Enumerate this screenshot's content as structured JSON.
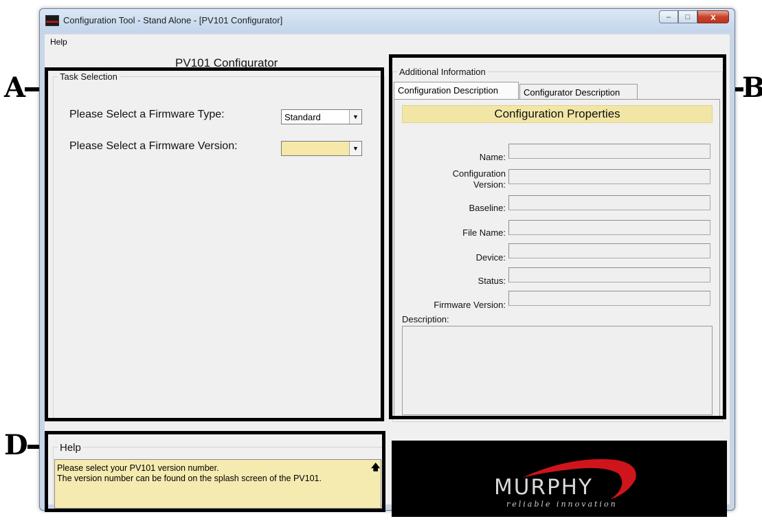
{
  "callouts": {
    "a": "A",
    "b": "B",
    "d": "D"
  },
  "window": {
    "title": "Configuration Tool - Stand Alone - [PV101 Configurator]",
    "controls": {
      "minimize": "–",
      "maximize": "□",
      "close": "x"
    }
  },
  "menu": {
    "items": [
      "Help"
    ]
  },
  "configurator": {
    "title": "PV101 Configurator",
    "task_selection": {
      "label": "Task Selection",
      "firmware_type_label": "Please Select a Firmware Type:",
      "firmware_type_value": "Standard",
      "firmware_version_label": "Please Select a Firmware Version:",
      "firmware_version_value": ""
    }
  },
  "additional_info": {
    "label": "Additional Information",
    "tabs": [
      "Configuration Description",
      "Configurator Description"
    ],
    "active_tab": "Configuration Description",
    "banner": "Configuration  Properties",
    "properties": [
      {
        "label": "Name:",
        "value": ""
      },
      {
        "label": "Configuration Version:",
        "value": ""
      },
      {
        "label": "Baseline:",
        "value": ""
      },
      {
        "label": "File Name:",
        "value": ""
      },
      {
        "label": "Device:",
        "value": ""
      },
      {
        "label": "Status:",
        "value": ""
      },
      {
        "label": "Firmware Version:",
        "value": ""
      }
    ],
    "description_label": "Description:",
    "description_value": ""
  },
  "help": {
    "label": "Help",
    "lines": [
      "Please select your PV101 version number.",
      "The version number can be found on the splash screen of the PV101."
    ]
  },
  "logo": {
    "word": "MURPHY",
    "tagline": "reliable innovation",
    "swoosh_color": "#d0141b"
  }
}
